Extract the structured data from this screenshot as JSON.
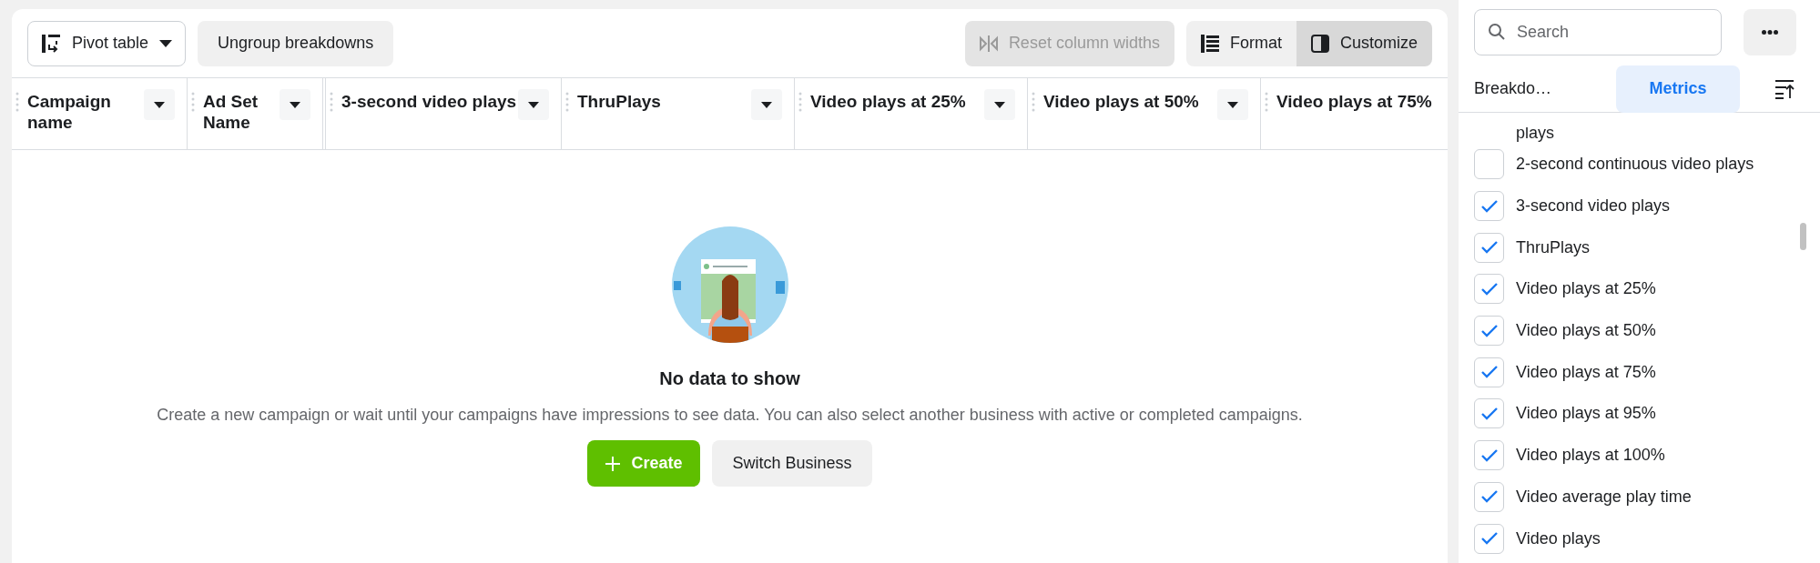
{
  "toolbar": {
    "view_button": {
      "label": "Pivot table"
    },
    "ungroup_button": {
      "label": "Ungroup breakdowns"
    },
    "reset_button": {
      "label": "Reset column widths",
      "disabled": true
    },
    "format_button": {
      "label": "Format",
      "selected": false
    },
    "customize_button": {
      "label": "Customize",
      "selected": true
    }
  },
  "table": {
    "columns": [
      {
        "label": "Campaign name",
        "has_menu": true
      },
      {
        "label": "Ad Set Name",
        "has_menu": true
      },
      {
        "label": "3-second video plays",
        "has_menu": true
      },
      {
        "label": "ThruPlays",
        "has_menu": true
      },
      {
        "label": "Video plays at 25%",
        "has_menu": true
      },
      {
        "label": "Video plays at 50%",
        "has_menu": true
      },
      {
        "label": "Video plays at 75%",
        "has_menu": false
      }
    ]
  },
  "empty_state": {
    "title": "No data to show",
    "message": "Create a new campaign or wait until your campaigns have impressions to see data. You can also select another business with active or completed campaigns.",
    "create_button": "Create",
    "switch_button": "Switch Business"
  },
  "side_panel": {
    "search": {
      "placeholder": "Search"
    },
    "tabs": [
      {
        "label": "Breakdo…",
        "selected": false
      },
      {
        "label": "Metrics",
        "selected": true
      }
    ],
    "partial_item": "plays",
    "items": [
      {
        "label": "2-second continuous video plays",
        "checked": false
      },
      {
        "label": "3-second video plays",
        "checked": true
      },
      {
        "label": "ThruPlays",
        "checked": true
      },
      {
        "label": "Video plays at 25%",
        "checked": true
      },
      {
        "label": "Video plays at 50%",
        "checked": true
      },
      {
        "label": "Video plays at 75%",
        "checked": true
      },
      {
        "label": "Video plays at 95%",
        "checked": true
      },
      {
        "label": "Video plays at 100%",
        "checked": true
      },
      {
        "label": "Video average play time",
        "checked": true
      },
      {
        "label": "Video plays",
        "checked": true
      }
    ]
  }
}
